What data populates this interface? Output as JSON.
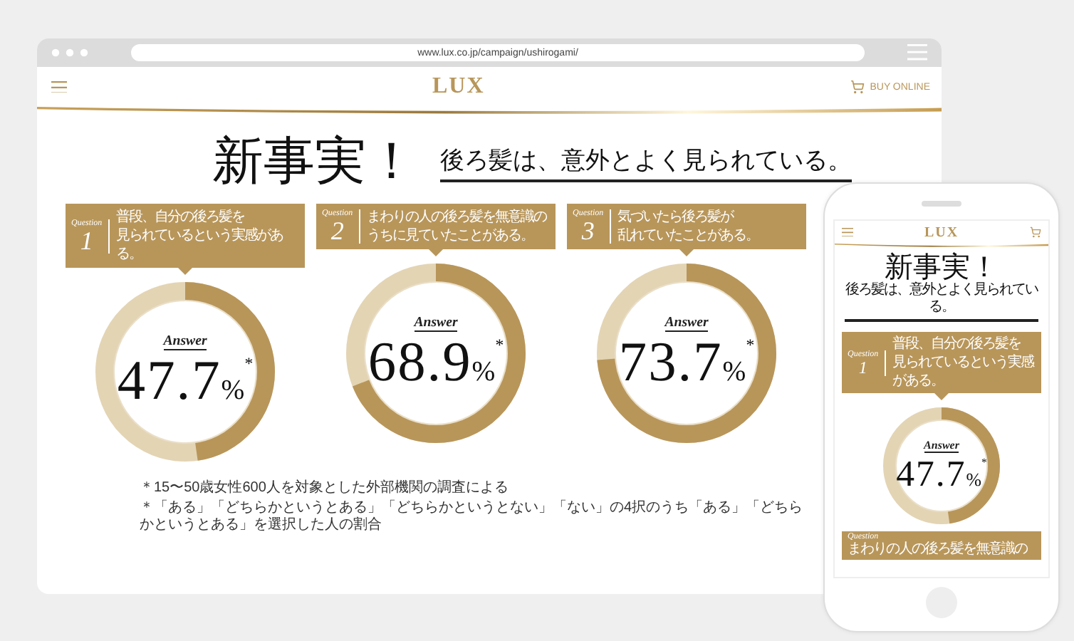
{
  "browser": {
    "url": "www.lux.co.jp/campaign/ushirogami/"
  },
  "header": {
    "logo": "LUX",
    "buy_online": "BUY ONLINE"
  },
  "headline": {
    "title": "新事実！",
    "subtitle": "後ろ髪は、意外とよく見られている。"
  },
  "questions": [
    {
      "label": "Question",
      "number": "1",
      "lines": [
        "普段、自分の後ろ髪を",
        "見られているという実感がある。"
      ],
      "answer_label": "Answer",
      "value": "47.7",
      "unit": "%",
      "note_mark": "*",
      "level": 0.477
    },
    {
      "label": "Question",
      "number": "2",
      "lines": [
        "まわりの人の後ろ髪を無意識の",
        "うちに見ていたことがある。"
      ],
      "answer_label": "Answer",
      "value": "68.9",
      "unit": "%",
      "note_mark": "*",
      "level": 0.689
    },
    {
      "label": "Question",
      "number": "3",
      "lines": [
        "気づいたら後ろ髪が",
        "乱れていたことがある。"
      ],
      "answer_label": "Answer",
      "value": "73.7",
      "unit": "%",
      "note_mark": "*",
      "level": 0.737
    }
  ],
  "footnotes": [
    "＊15〜50歳女性600人を対象とした外部機関の調査による",
    "＊「ある」「どちらかというとある」「どちらかというとない」「ない」の4択のうち「ある」「どちらかというとある」を選択した人の割合"
  ],
  "phone": {
    "logo": "LUX",
    "title": "新事実！",
    "subtitle": "後ろ髪は、意外とよく見られている。",
    "question": {
      "label": "Question",
      "number": "1",
      "lines": [
        "普段、自分の後ろ髪を",
        "見られているという実感がある。"
      ],
      "answer_label": "Answer",
      "value": "47.7",
      "unit": "%",
      "note_mark": "*",
      "level": 0.477
    },
    "next_question": {
      "label": "Question",
      "text": "まわりの人の後ろ髪を無意識の"
    }
  }
}
